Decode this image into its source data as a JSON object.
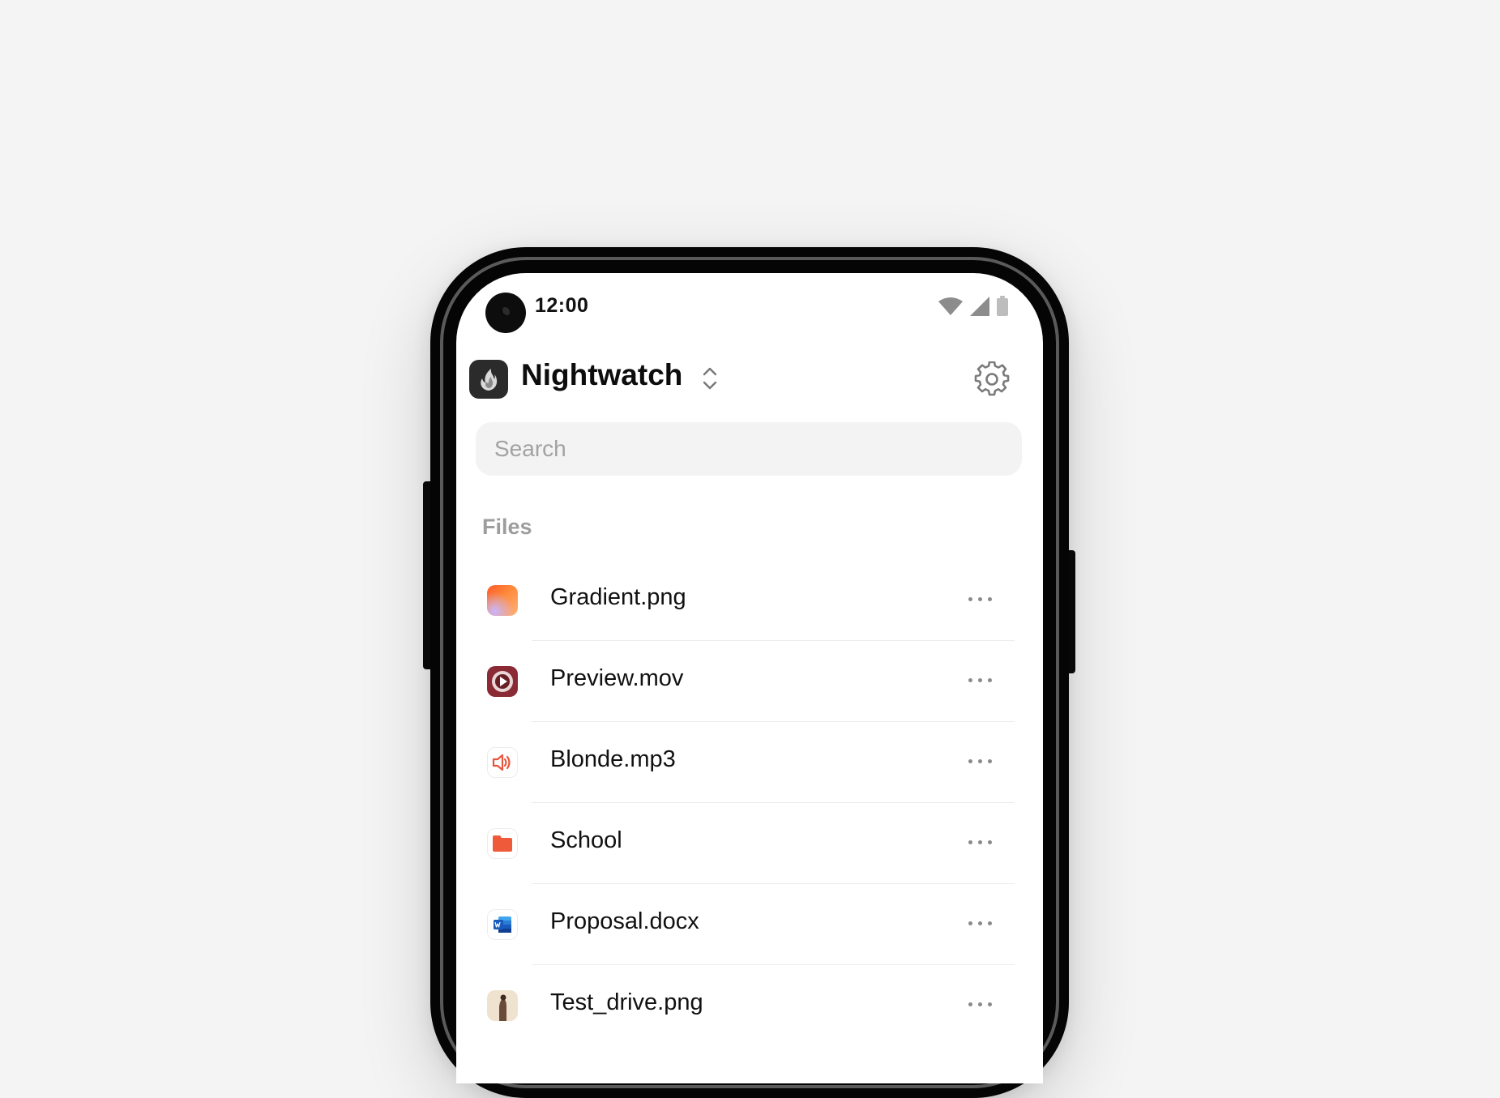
{
  "status_bar": {
    "time": "12:00"
  },
  "header": {
    "app_name": "Nightwatch"
  },
  "search": {
    "placeholder": "Search"
  },
  "files_section": {
    "label": "Files",
    "items": [
      {
        "name": "Gradient.png",
        "icon": "gradient-image-icon"
      },
      {
        "name": "Preview.mov",
        "icon": "video-file-icon"
      },
      {
        "name": "Blonde.mp3",
        "icon": "audio-file-icon"
      },
      {
        "name": "School",
        "icon": "folder-icon"
      },
      {
        "name": "Proposal.docx",
        "icon": "word-doc-icon"
      },
      {
        "name": "Test_drive.png",
        "icon": "photo-thumbnail-icon"
      }
    ]
  },
  "colors": {
    "folder": "#ef5a3a",
    "audio": "#e8553e",
    "word": "#1f5cc4",
    "video": "#8a2a34"
  }
}
